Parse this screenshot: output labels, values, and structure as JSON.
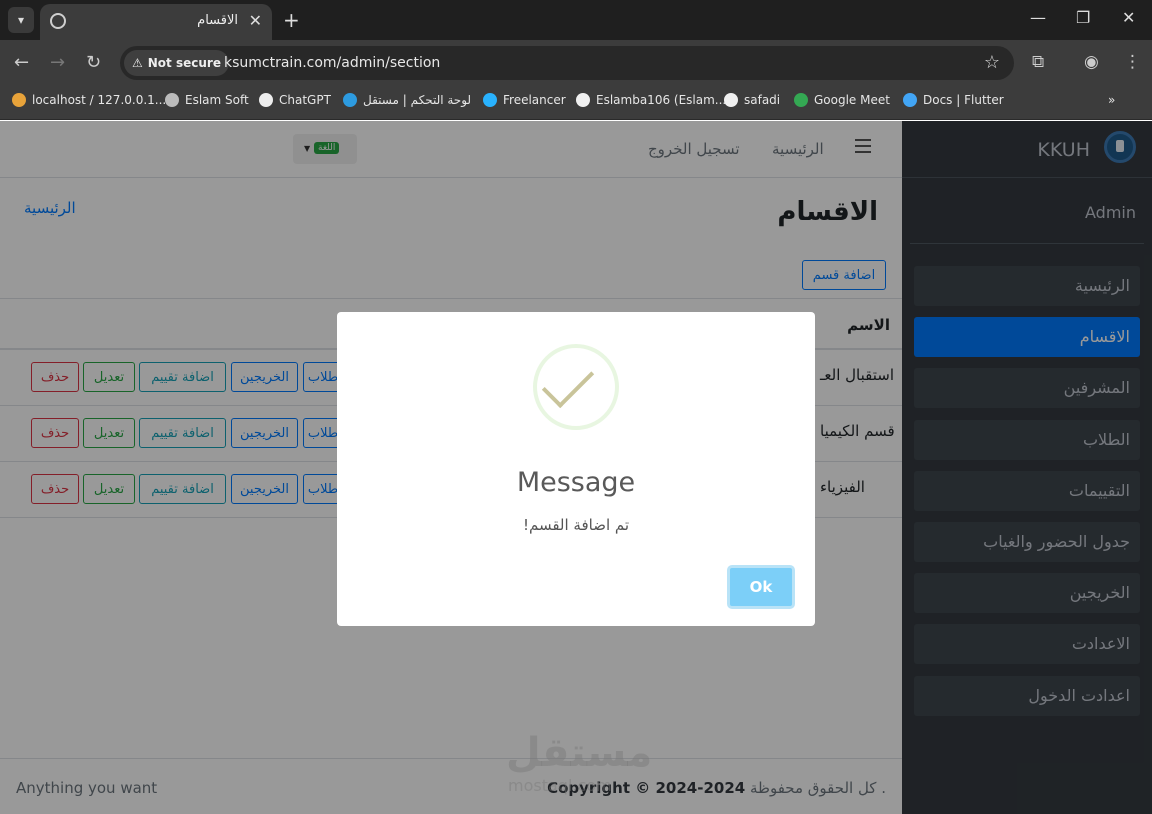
{
  "browser": {
    "tab_title": "الاقسام",
    "not_secure": "Not secure",
    "url": "ksumctrain.com/admin/section",
    "bookmarks": [
      "localhost / 127.0.0.1...",
      "Eslam Soft",
      "ChatGPT",
      "لوحة التحكم | مستقل",
      "Freelancer",
      "Eslamba106 (Eslam...",
      "safadi",
      "Google Meet",
      "Docs | Flutter"
    ]
  },
  "topnav": {
    "home": "الرئيسية",
    "logout": "تسجيل الخروج",
    "lang_badge": "اللغة"
  },
  "page": {
    "title": "الاقسام",
    "breadcrumb": "الرئيسية",
    "add_button": "اضافة قسم",
    "table_header": "الاسم",
    "rows": [
      {
        "name": "استقبال العـ"
      },
      {
        "name": "قسم الكيميا"
      },
      {
        "name": "الفيزياء"
      }
    ],
    "row_buttons": {
      "delete": "حذف",
      "edit": "تعديل",
      "add_rating": "اضافة تقييم",
      "graduates": "الخريجين",
      "students": "طلاب"
    }
  },
  "footer": {
    "left": "Anything you want",
    "copyright": "Copyright © 2024-2024",
    "rights": "كل الحقوق محفوظة ."
  },
  "sidebar": {
    "brand": "KKUH",
    "user": "Admin",
    "items": [
      {
        "label": "الرئيسية"
      },
      {
        "label": "الاقسام"
      },
      {
        "label": "المشرفين"
      },
      {
        "label": "الطلاب"
      },
      {
        "label": "التقييمات"
      },
      {
        "label": "جدول الحضور والغياب"
      },
      {
        "label": "الخريجين"
      },
      {
        "label": "الاعدادت"
      },
      {
        "label": "اعدادت الدخول"
      }
    ],
    "active_item": "الاقسام"
  },
  "modal": {
    "title": "Message",
    "text": "تم اضافة القسم!",
    "ok": "Ok"
  },
  "watermark": {
    "arabic": "مستقل",
    "latin": "mostaql.com"
  },
  "colors": {
    "primary": "#007bff",
    "sidebar": "#343a40",
    "success": "#28a745",
    "danger": "#dc3545",
    "info": "#17a2b8"
  }
}
